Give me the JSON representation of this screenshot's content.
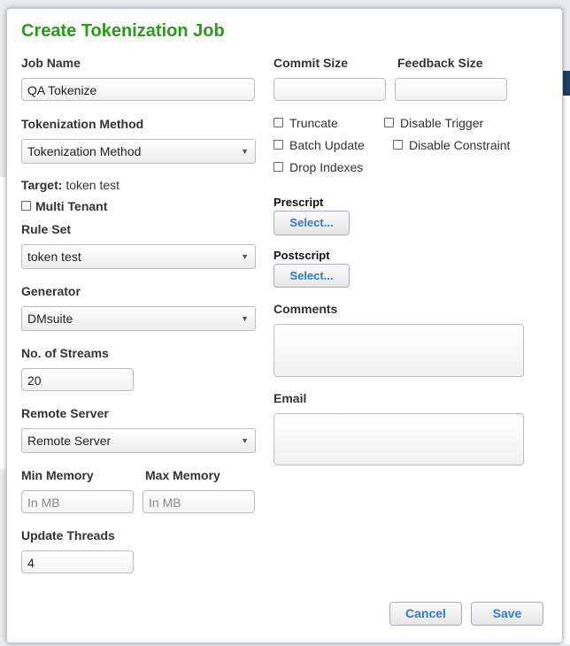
{
  "dialog": {
    "title": "Create Tokenization Job",
    "cancel_label": "Cancel",
    "save_label": "Save"
  },
  "fields": {
    "job_name": {
      "label": "Job Name",
      "value": "QA Tokenize"
    },
    "tokenization_method": {
      "label": "Tokenization Method",
      "selected": "Tokenization Method"
    },
    "target": {
      "label": "Target:",
      "value": "token test"
    },
    "multi_tenant": {
      "label": "Multi Tenant",
      "checked": false
    },
    "rule_set": {
      "label": "Rule Set",
      "selected": "token test"
    },
    "generator": {
      "label": "Generator",
      "selected": "DMsuite"
    },
    "streams": {
      "label": "No. of Streams",
      "value": "20"
    },
    "remote_server": {
      "label": "Remote Server",
      "selected": "Remote Server"
    },
    "min_memory": {
      "label": "Min Memory",
      "placeholder": "In MB"
    },
    "max_memory": {
      "label": "Max Memory",
      "placeholder": "In MB"
    },
    "update_threads": {
      "label": "Update Threads",
      "value": "4"
    },
    "commit_size": {
      "label": "Commit Size",
      "value": ""
    },
    "feedback_size": {
      "label": "Feedback Size",
      "value": ""
    },
    "options": {
      "truncate": "Truncate",
      "disable_trigger": "Disable Trigger",
      "batch_update": "Batch Update",
      "disable_constraint": "Disable Constraint",
      "drop_indexes": "Drop Indexes"
    },
    "prescript": {
      "label": "Prescript",
      "button": "Select..."
    },
    "postscript": {
      "label": "Postscript",
      "button": "Select..."
    },
    "comments": {
      "label": "Comments",
      "value": ""
    },
    "email": {
      "label": "Email",
      "value": ""
    }
  },
  "colors": {
    "title": "#2a9a1a",
    "button_text": "#2f7ad0"
  },
  "icons": {
    "select_arrow": "chevron-down-icon"
  }
}
